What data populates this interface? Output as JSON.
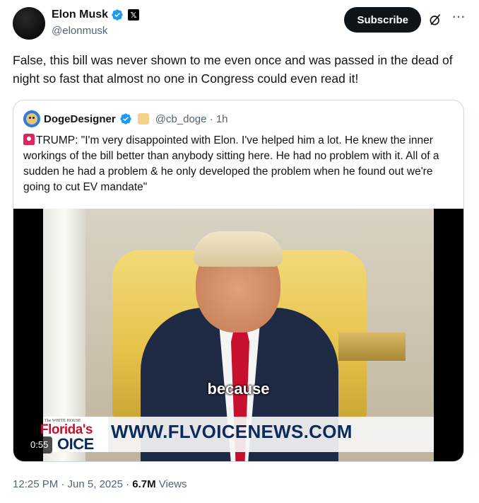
{
  "author": {
    "name": "Elon Musk",
    "handle": "@elonmusk",
    "affiliate_badge": "𝕏"
  },
  "actions": {
    "subscribe_label": "Subscribe"
  },
  "tweet": {
    "text": "False, this bill was never shown to me even once and was passed in the dead of night so fast that almost no one in Congress could even read it!"
  },
  "quoted": {
    "name": "DogeDesigner",
    "handle_time": "@cb_doge · 1h",
    "text": "TRUMP: \"I'm very disappointed with Elon. I've helped him a lot. He knew the inner workings of the bill better than anybody sitting here. He had no problem with it. All of a sudden he had a problem & he only developed the problem when he found out we're going to cut EV mandate\"",
    "video": {
      "caption": "because",
      "timestamp": "0:55",
      "banner_small": "The WHITE HOUSE",
      "banner_logo_line1": "Florida's",
      "banner_logo_line2": "OICE",
      "banner_url": "WWW.FLVOICENEWS.COM"
    }
  },
  "footer": {
    "time_date": "12:25 PM · Jun 5, 2025 · ",
    "views_count": "6.7M",
    "views_label": " Views"
  },
  "colors": {
    "verified_blue": "#1d9bf0",
    "text_primary": "#0f1419",
    "text_secondary": "#536471",
    "border": "#cfd9de"
  }
}
